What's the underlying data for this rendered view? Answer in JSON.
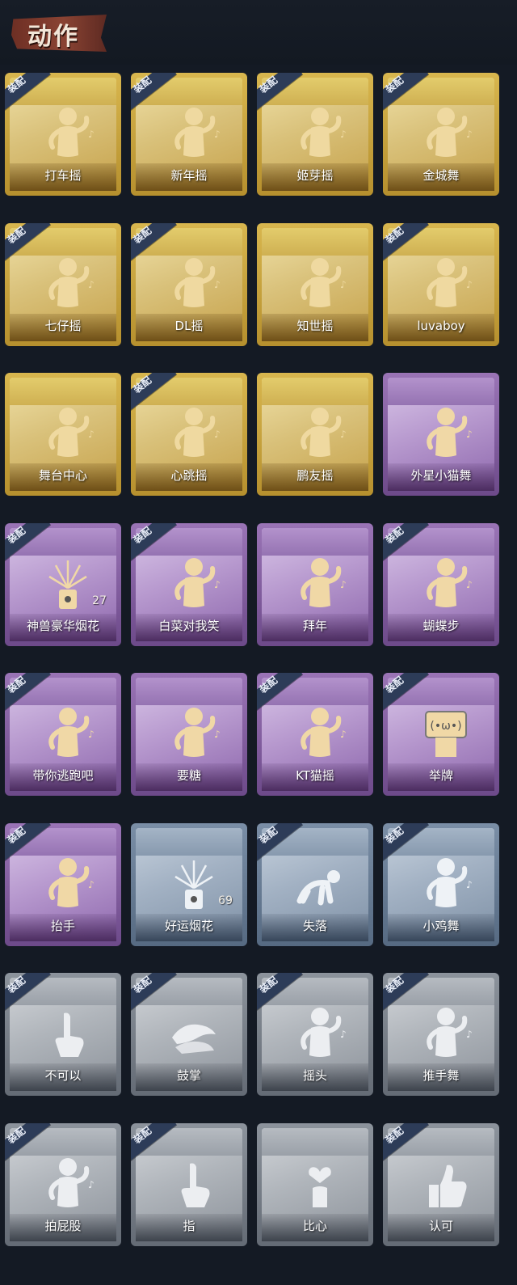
{
  "header": {
    "title": "动作"
  },
  "equip_label": "装配",
  "cards": [
    {
      "label": "打车摇",
      "rarity": "gold",
      "equipped": true,
      "icon": "dancer-icon"
    },
    {
      "label": "新年摇",
      "rarity": "gold",
      "equipped": true,
      "icon": "dancer-icon"
    },
    {
      "label": "姬芽摇",
      "rarity": "gold",
      "equipped": true,
      "icon": "dancer-icon"
    },
    {
      "label": "金城舞",
      "rarity": "gold",
      "equipped": true,
      "icon": "dancer-icon"
    },
    {
      "label": "七仔摇",
      "rarity": "gold",
      "equipped": true,
      "icon": "dancer-icon"
    },
    {
      "label": "DL摇",
      "rarity": "gold",
      "equipped": true,
      "icon": "dancer-icon"
    },
    {
      "label": "知世摇",
      "rarity": "gold",
      "equipped": false,
      "icon": "dancer-icon"
    },
    {
      "label": "luvaboy",
      "rarity": "gold",
      "equipped": true,
      "icon": "dancer-icon"
    },
    {
      "label": "舞台中心",
      "rarity": "gold",
      "equipped": false,
      "icon": "dancer-icon"
    },
    {
      "label": "心跳摇",
      "rarity": "gold",
      "equipped": true,
      "icon": "dancer-icon"
    },
    {
      "label": "鹏友摇",
      "rarity": "gold",
      "equipped": false,
      "icon": "dancer-icon"
    },
    {
      "label": "外星小猫舞",
      "rarity": "purple",
      "equipped": false,
      "icon": "dancer-icon"
    },
    {
      "label": "神兽豪华烟花",
      "rarity": "purple",
      "equipped": true,
      "icon": "firework-icon",
      "count": "27"
    },
    {
      "label": "白菜对我笑",
      "rarity": "purple",
      "equipped": true,
      "icon": "dancer-icon"
    },
    {
      "label": "拜年",
      "rarity": "purple",
      "equipped": false,
      "icon": "bow-icon"
    },
    {
      "label": "蝴蝶步",
      "rarity": "purple",
      "equipped": true,
      "icon": "dancer-icon"
    },
    {
      "label": "带你逃跑吧",
      "rarity": "purple",
      "equipped": true,
      "icon": "dancer-icon"
    },
    {
      "label": "要糖",
      "rarity": "purple",
      "equipped": false,
      "icon": "figure-icon"
    },
    {
      "label": "KT猫摇",
      "rarity": "purple",
      "equipped": true,
      "icon": "dancer-icon"
    },
    {
      "label": "举牌",
      "rarity": "purple",
      "equipped": true,
      "icon": "sign-icon"
    },
    {
      "label": "抬手",
      "rarity": "purple",
      "equipped": true,
      "icon": "figure-icon"
    },
    {
      "label": "好运烟花",
      "rarity": "blue",
      "equipped": false,
      "icon": "firework-icon",
      "count": "69"
    },
    {
      "label": "失落",
      "rarity": "blue",
      "equipped": true,
      "icon": "crawl-icon"
    },
    {
      "label": "小鸡舞",
      "rarity": "blue",
      "equipped": true,
      "icon": "figure-icon"
    },
    {
      "label": "不可以",
      "rarity": "grey",
      "equipped": true,
      "icon": "finger-icon"
    },
    {
      "label": "鼓掌",
      "rarity": "grey",
      "equipped": true,
      "icon": "clap-icon"
    },
    {
      "label": "摇头",
      "rarity": "grey",
      "equipped": true,
      "icon": "figure-icon"
    },
    {
      "label": "推手舞",
      "rarity": "grey",
      "equipped": true,
      "icon": "figure-icon"
    },
    {
      "label": "拍屁股",
      "rarity": "grey",
      "equipped": true,
      "icon": "figure-icon"
    },
    {
      "label": "指",
      "rarity": "grey",
      "equipped": true,
      "icon": "point-icon"
    },
    {
      "label": "比心",
      "rarity": "grey",
      "equipped": false,
      "icon": "heart-hand-icon"
    },
    {
      "label": "认可",
      "rarity": "grey",
      "equipped": true,
      "icon": "thumbs-up-icon"
    }
  ]
}
